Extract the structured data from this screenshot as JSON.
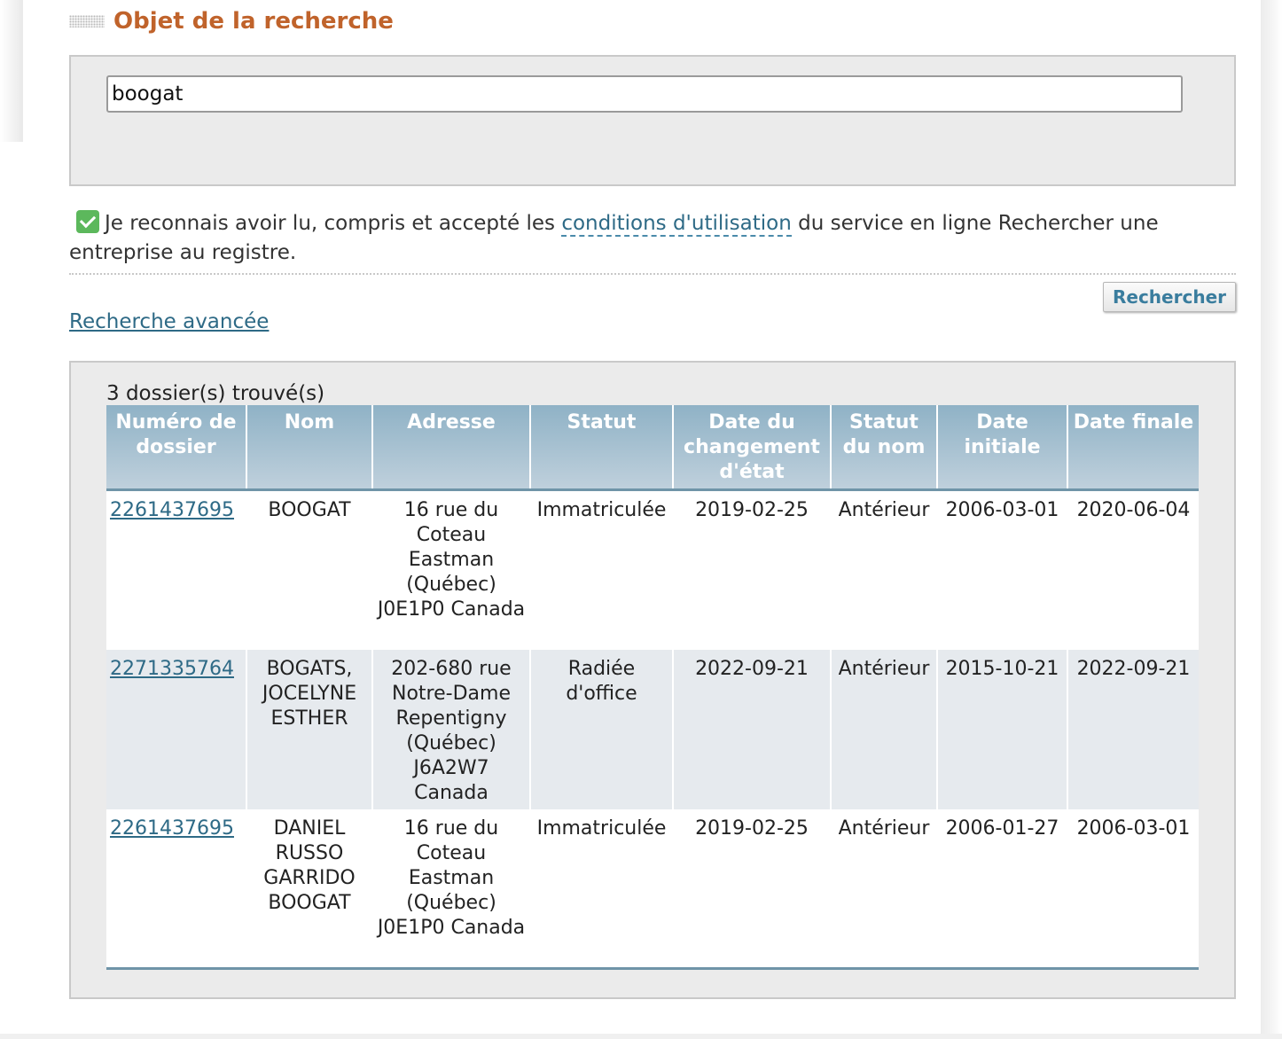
{
  "header": {
    "title": "Objet de la recherche"
  },
  "search": {
    "value": "boogat"
  },
  "consent": {
    "text_before": "Je reconnais avoir lu, compris et accepté les ",
    "link_label": "conditions d'utilisation",
    "text_after": " du service en ligne Rechercher une entreprise au registre.",
    "checked": true
  },
  "actions": {
    "search_button": "Rechercher",
    "advanced_link": "Recherche avancée"
  },
  "results": {
    "count_label": "3 dossier(s) trouvé(s)",
    "columns": [
      "Numéro de dossier",
      "Nom",
      "Adresse",
      "Statut",
      "Date du changement d'état",
      "Statut du nom",
      "Date initiale",
      "Date finale"
    ],
    "rows": [
      {
        "dossier": "2261437695",
        "nom": "BOOGAT",
        "adresse": "16 rue du Coteau Eastman (Québec) J0E1P0 Canada",
        "statut": "Immatriculée",
        "date_changement": "2019-02-25",
        "statut_nom": "Antérieur",
        "date_initiale": "2006-03-01",
        "date_finale": "2020-06-04"
      },
      {
        "dossier": "2271335764",
        "nom": "BOGATS, JOCELYNE ESTHER",
        "adresse": "202-680 rue Notre-Dame Repentigny (Québec) J6A2W7 Canada",
        "statut": "Radiée d'office",
        "date_changement": "2022-09-21",
        "statut_nom": "Antérieur",
        "date_initiale": "2015-10-21",
        "date_finale": "2022-09-21"
      },
      {
        "dossier": "2261437695",
        "nom": "DANIEL RUSSO GARRIDO BOOGAT",
        "adresse": "16 rue du Coteau Eastman (Québec) J0E1P0 Canada",
        "statut": "Immatriculée",
        "date_changement": "2019-02-25",
        "statut_nom": "Antérieur",
        "date_initiale": "2006-01-27",
        "date_finale": "2006-03-01"
      }
    ]
  },
  "colors": {
    "title": "#c0632b",
    "link": "#2e6a86",
    "header_bg": "#a9c2d2",
    "checkbox": "#5cb85c"
  }
}
